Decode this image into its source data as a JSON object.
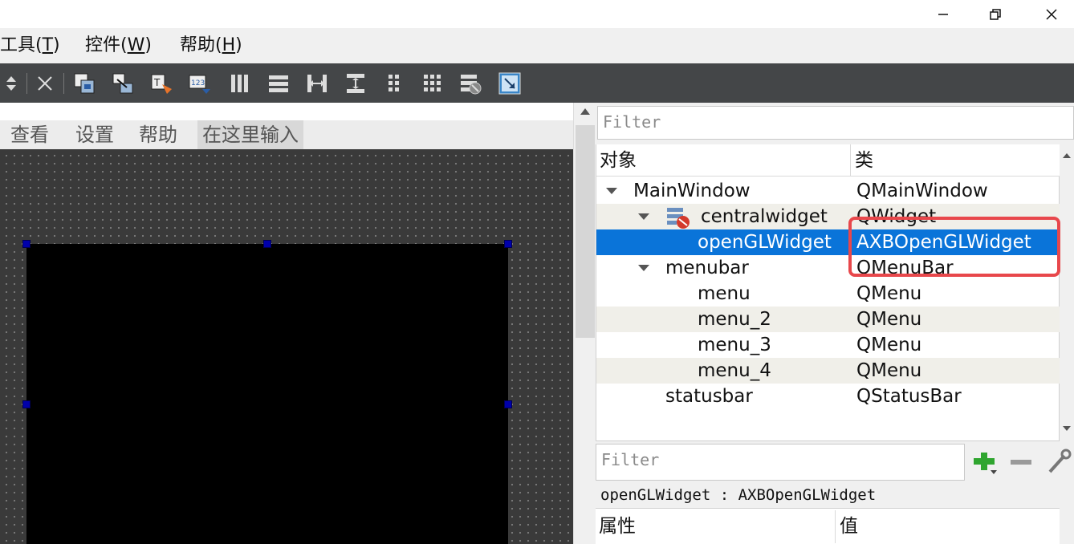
{
  "window_controls": {
    "minimize": "minimize-icon",
    "restore": "restore-icon",
    "close": "close-icon"
  },
  "menubar": {
    "items": [
      {
        "label_pre": "工具(",
        "mnemonic": "T",
        "label_post": ")"
      },
      {
        "label_pre": "控件(",
        "mnemonic": "W",
        "label_post": ")"
      },
      {
        "label_pre": "帮助(",
        "mnemonic": "H",
        "label_post": ")"
      }
    ]
  },
  "toolbar": {
    "icons": [
      "arrows-updown-icon",
      "close-x-icon",
      "edit-widgets-icon",
      "edit-signals-slots-icon",
      "edit-buddies-icon",
      "edit-tab-order-icon",
      "layout-horizontal-icon",
      "layout-vertical-icon",
      "layout-horizontal-splitter-icon",
      "layout-vertical-splitter-icon",
      "layout-form-icon",
      "layout-grid-icon",
      "break-layout-icon",
      "adjust-size-icon"
    ]
  },
  "form": {
    "menu_items": [
      "查看",
      "设置",
      "帮助"
    ],
    "menu_input_placeholder": "在这里输入"
  },
  "object_inspector": {
    "filter_placeholder": "Filter",
    "col_object": "对象",
    "col_class": "类",
    "rows": [
      {
        "object": "MainWindow",
        "class": "QMainWindow"
      },
      {
        "object": "centralwidget",
        "class": "QWidget"
      },
      {
        "object": "openGLWidget",
        "class": "AXBOpenGLWidget"
      },
      {
        "object": "menubar",
        "class": "QMenuBar"
      },
      {
        "object": "menu",
        "class": "QMenu"
      },
      {
        "object": "menu_2",
        "class": "QMenu"
      },
      {
        "object": "menu_3",
        "class": "QMenu"
      },
      {
        "object": "menu_4",
        "class": "QMenu"
      },
      {
        "object": "statusbar",
        "class": "QStatusBar"
      }
    ],
    "selected_object": "openGLWidget"
  },
  "property_editor": {
    "filter_placeholder": "Filter",
    "class_line": "openGLWidget : AXBOpenGLWidget",
    "col_property": "属性",
    "col_value": "值"
  },
  "colors": {
    "selection": "#0a74d9",
    "highlight_box": "#e8474b",
    "toolbar_bg": "#444648"
  }
}
